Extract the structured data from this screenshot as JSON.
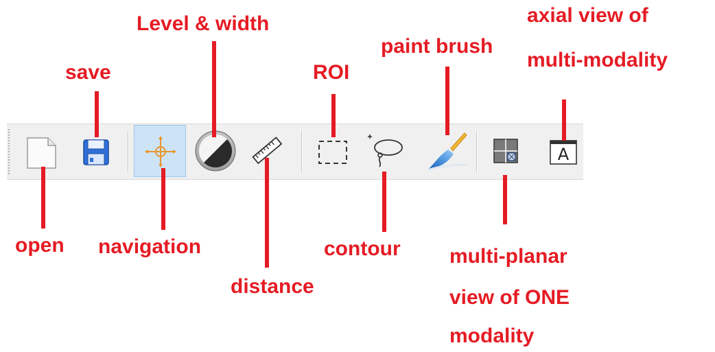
{
  "labels": {
    "level_width": "Level & width",
    "save": "save",
    "roi": "ROI",
    "paint_brush": "paint brush",
    "axial_view": [
      "axial view of",
      "multi-modality"
    ],
    "open": "open",
    "navigation": "navigation",
    "distance": "distance",
    "contour": "contour",
    "multi_planar": [
      "multi-planar",
      "view of ONE",
      "modality"
    ]
  },
  "toolbar": {
    "active_tool": "navigation",
    "axial_button_letter": "A"
  },
  "colors": {
    "annotation": "#e51b24",
    "toolbar_bg": "#f0f0f0",
    "active_bg": "#cde4f7",
    "navigation_icon": "#e8962c",
    "save_icon": "#2f6fd8"
  },
  "icons": {
    "open": "blank-document-icon",
    "save": "floppy-disk-icon",
    "navigation": "crosshair-icon",
    "level_width": "contrast-circle-icon",
    "distance": "ruler-icon",
    "roi": "dashed-rectangle-icon",
    "contour": "lasso-icon",
    "paint_brush": "paint-brush-icon",
    "multi_planar": "grid-layout-icon",
    "axial_view": "axial-window-icon"
  }
}
